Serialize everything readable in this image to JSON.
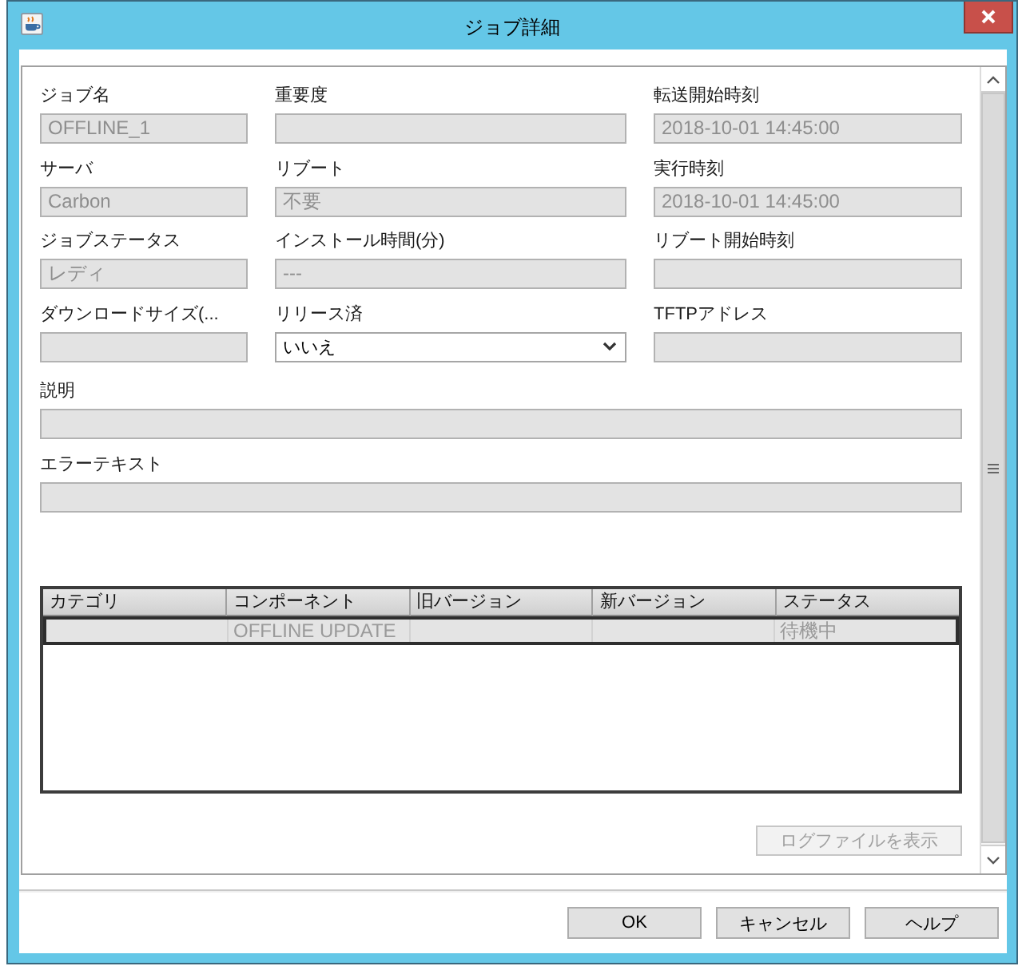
{
  "window": {
    "title": "ジョブ詳細"
  },
  "fields": [
    {
      "label": "ジョブ名",
      "value": "OFFLINE_1",
      "kind": "text",
      "disabled": true
    },
    {
      "label": "重要度",
      "kind": "text",
      "disabled": true
    },
    {
      "label": "転送開始時刻",
      "value": "2018-10-01 14:45:00",
      "kind": "text",
      "disabled": true
    },
    {
      "label": "サーバ",
      "value": "Carbon",
      "kind": "text",
      "disabled": true
    },
    {
      "label": "リブート",
      "value": "不要",
      "kind": "text",
      "disabled": true
    },
    {
      "label": "実行時刻",
      "value": "2018-10-01 14:45:00",
      "kind": "text",
      "disabled": true
    },
    {
      "label": "ジョブステータス",
      "value": "レディ",
      "kind": "text",
      "disabled": true
    },
    {
      "label": "インストール時間(分)",
      "value": "---",
      "kind": "text",
      "disabled": true
    },
    {
      "label": "リブート開始時刻",
      "kind": "text",
      "disabled": true
    },
    {
      "label": "ダウンロードサイズ(...",
      "kind": "text",
      "disabled": true
    },
    {
      "label": "リリース済",
      "value": "いいえ",
      "kind": "select",
      "disabled": false
    },
    {
      "label": "TFTPアドレス",
      "kind": "text",
      "disabled": true
    }
  ],
  "wide_fields": [
    {
      "label": "説明",
      "kind": "text",
      "disabled": true
    },
    {
      "label": "エラーテキスト",
      "kind": "text",
      "disabled": true
    }
  ],
  "table": {
    "columns": [
      "カテゴリ",
      "コンポーネント",
      "旧バージョン",
      "新バージョン",
      "ステータス"
    ],
    "rows": [
      {
        "cells": [
          null,
          "OFFLINE UPDATE",
          null,
          null,
          "待機中"
        ],
        "selected": true
      }
    ]
  },
  "log_button": {
    "label": "ログファイルを表示",
    "disabled": true
  },
  "buttons": [
    "OK",
    "キャンセル",
    "ヘルプ"
  ]
}
